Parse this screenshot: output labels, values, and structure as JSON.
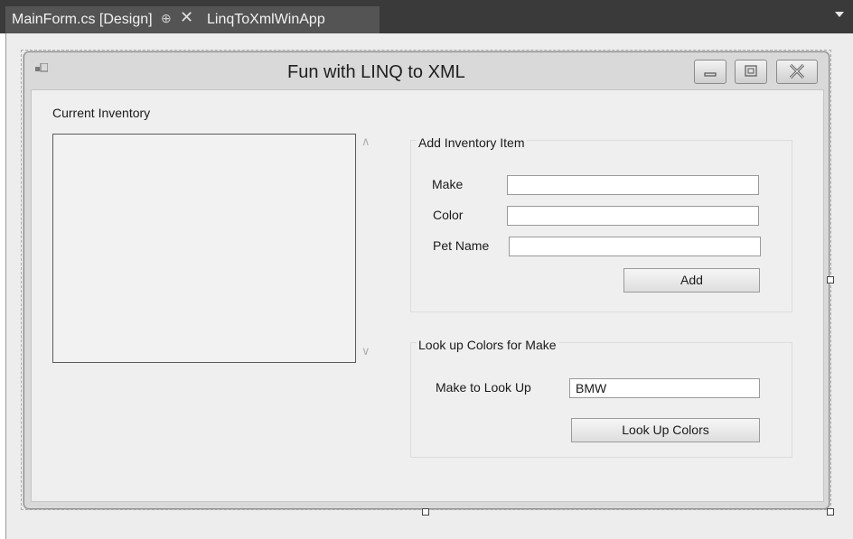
{
  "tabs": {
    "designer_tab": "MainForm.cs [Design]",
    "project_tab": "LinqToXmlWinApp"
  },
  "form": {
    "title": "Fun with LINQ to XML",
    "inventory_label": "Current Inventory",
    "add_group": {
      "title": "Add Inventory Item",
      "make_label": "Make",
      "make_value": "",
      "color_label": "Color",
      "color_value": "",
      "petname_label": "Pet Name",
      "petname_value": "",
      "add_button": "Add"
    },
    "lookup_group": {
      "title": "Look up Colors for Make",
      "make_label": "Make to Look Up",
      "make_value": "BMW",
      "lookup_button": "Look Up Colors"
    }
  },
  "icons": {
    "pin": "pin-icon",
    "close": "close-icon",
    "minimize": "minimize-icon",
    "maximize": "maximize-icon",
    "window_close": "window-close-icon"
  }
}
